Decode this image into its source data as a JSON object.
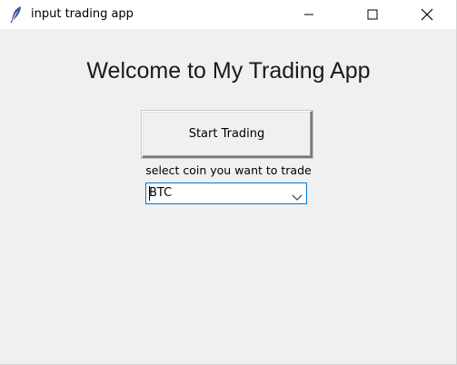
{
  "window": {
    "title": "input trading app",
    "icon": "feather-icon"
  },
  "controls": {
    "minimize_icon": "minimize-icon",
    "maximize_icon": "maximize-icon",
    "close_icon": "close-icon"
  },
  "main": {
    "heading": "Welcome to My Trading App",
    "start_button_label": "Start Trading",
    "coin_label": "select coin you want to trade",
    "coin_select": {
      "value": "BTC",
      "icon": "chevron-down-icon"
    }
  },
  "colors": {
    "window_bg": "#f0f0f0",
    "titlebar_bg": "#ffffff",
    "focus_border": "#0078d7"
  }
}
